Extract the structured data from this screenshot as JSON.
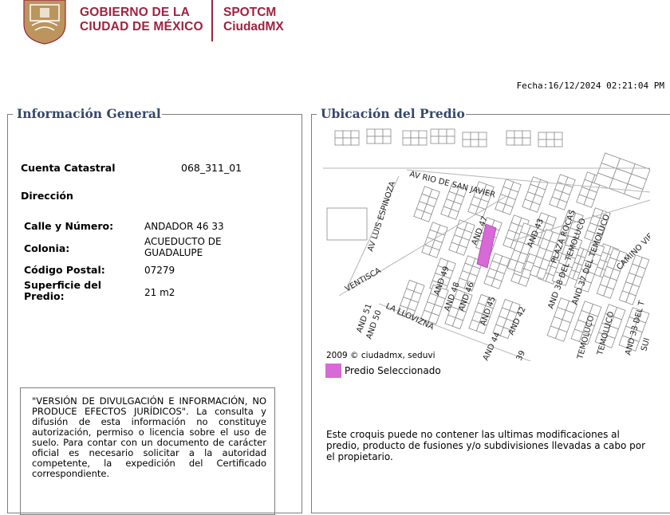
{
  "header": {
    "gov_line1": "GOBIERNO DE LA",
    "gov_line2": "CIUDAD DE MÉXICO",
    "brand_line1": "SPOTCM",
    "brand_line2": "CiudadMX"
  },
  "fecha": "Fecha:16/12/2024 02:21:04 PM",
  "general": {
    "legend": "Información General",
    "cuenta_label": "Cuenta Catastral",
    "cuenta_value": "068_311_01",
    "direccion_label": "Dirección",
    "calle_label": "Calle y Número:",
    "calle_value": "ANDADOR 46 33",
    "colonia_label": "Colonia:",
    "colonia_value_1": "ACUEDUCTO DE",
    "colonia_value_2": "GUADALUPE",
    "cp_label": "Código Postal:",
    "cp_value": "07279",
    "superficie_label_1": "Superficie del",
    "superficie_label_2": "Predio:",
    "superficie_value": "21 m2",
    "disclaimer": "\"VERSIÓN DE DIVULGACIÓN E INFORMACIÓN, NO PRODUCE EFECTOS JURÍDICOS\". La consulta y difusión de esta información no constituye autorización, permiso o licencia sobre el uso de suelo. Para contar con un documento de carácter oficial es necesario solicitar a la autoridad competente, la expedición del Certificado correspondiente."
  },
  "ubicacion": {
    "legend": "Ubicación del Predio",
    "street_labels": [
      "AV RIO DE SAN JAVIER",
      "AV LUIS ESPINOZA",
      "VENTISCA",
      "AND 47",
      "AND 43",
      "PLAZA ROCAS",
      "AND 38 DEL TEMOLUCO",
      "AND 37 DEL TEMOLUCO",
      "CAMINO VIE",
      "AND 49",
      "AND 48",
      "AND 46",
      "AND 45",
      "AND 51",
      "AND 50",
      "LA LLOVIZNA",
      "AND 42",
      "AND 44",
      "39",
      "TEMOLUCO",
      "TEMOLUCO",
      "AND 33 DEL T",
      "SUI"
    ],
    "copyright": "2009 © ciudadmx, seduvi",
    "legend_item": "Predio Seleccionado",
    "croquis_note": "Este croquis puede no contener las ultimas modificaciones al predio, producto de fusiones y/o subdivisiones llevadas a cabo por el propietario."
  },
  "colors": {
    "brand": "#9f2241",
    "legend_title": "#36486b",
    "selected_parcel": "#d76ad6"
  }
}
